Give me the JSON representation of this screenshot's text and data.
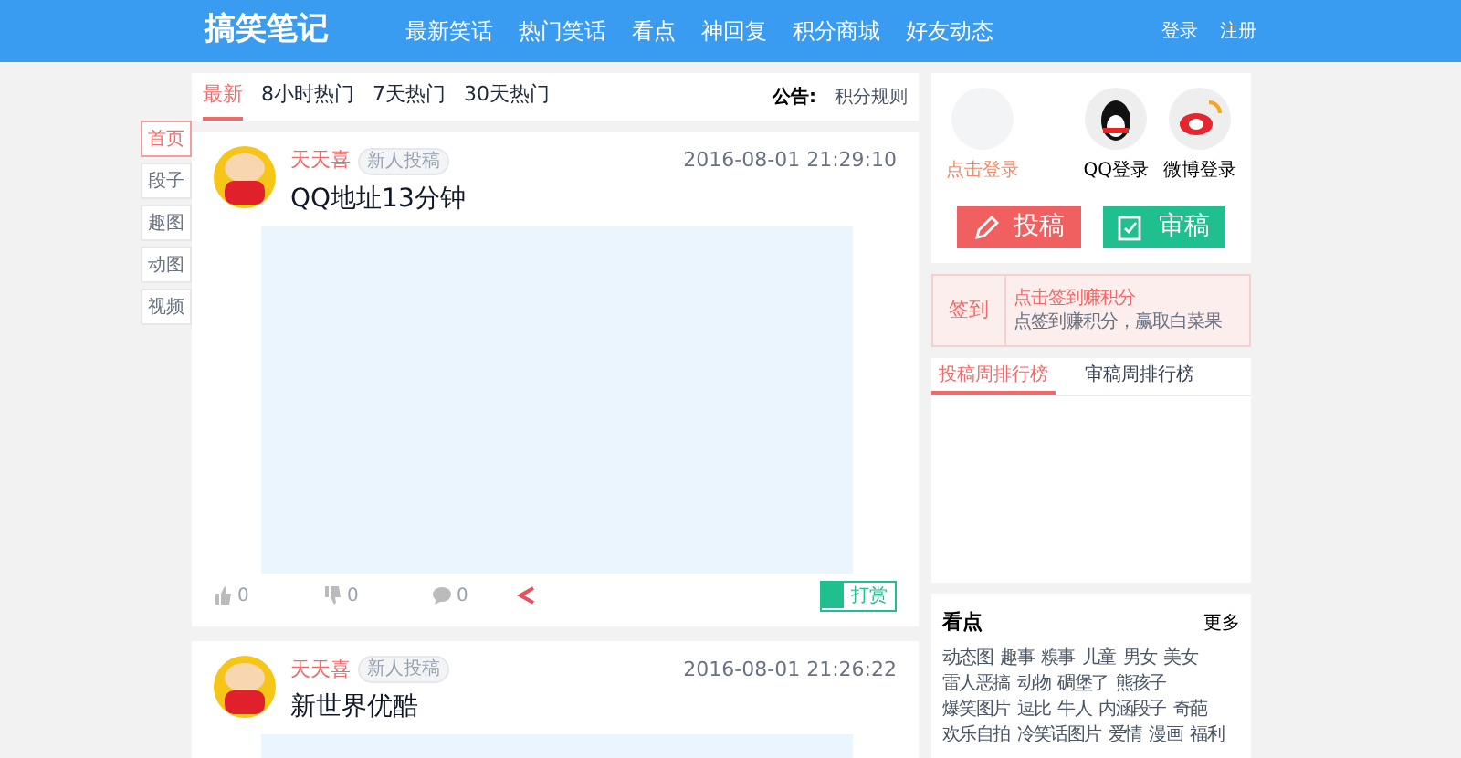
{
  "header": {
    "logo": "搞笑笔记",
    "nav": [
      {
        "label": "最新笑话"
      },
      {
        "label": "热门笑话"
      },
      {
        "label": "看点"
      },
      {
        "label": "神回复"
      },
      {
        "label": "积分商城"
      },
      {
        "label": "好友动态"
      }
    ],
    "actions": [
      "登录",
      "注册"
    ]
  },
  "side_tabs": [
    {
      "label": "首页",
      "selected": true
    },
    {
      "label": "段子",
      "selected": false
    },
    {
      "label": "趣图",
      "selected": false
    },
    {
      "label": "动图",
      "selected": false
    },
    {
      "label": "视频",
      "selected": false
    }
  ],
  "feed_tabs": [
    {
      "label": "最新",
      "selected": true
    },
    {
      "label": "8小时热门",
      "selected": false
    },
    {
      "label": "7天热门",
      "selected": false
    },
    {
      "label": "30天热门",
      "selected": false
    }
  ],
  "notice": {
    "label": "公告:",
    "link": "积分规则"
  },
  "posts": [
    {
      "author": "天天喜",
      "badge": "新人投稿",
      "time": "2016-08-01 21:29:10",
      "title": "QQ地址13分钟",
      "likes": "0",
      "dislikes": "0",
      "comments": "0",
      "tip": "打赏"
    },
    {
      "author": "天天喜",
      "badge": "新人投稿",
      "time": "2016-08-01 21:26:22",
      "title": "新世界优酷"
    }
  ],
  "login": {
    "prompt": "点击登录",
    "qq": "QQ登录",
    "weibo": "微博登录"
  },
  "buttons": {
    "submit": "投稿",
    "review": "审稿"
  },
  "signin": {
    "label": "签到",
    "hint": "点击签到赚积分",
    "desc": "点签到赚积分，赢取白菜果"
  },
  "rank_tabs": [
    {
      "label": "投稿周排行榜",
      "selected": true
    },
    {
      "label": "审稿周排行榜",
      "selected": false
    }
  ],
  "hot": {
    "title": "看点",
    "more": "更多",
    "tags": [
      "动态图",
      "趣事",
      "糗事",
      "儿童",
      "男女",
      "美女",
      "雷人恶搞",
      "动物",
      "碉堡了",
      "熊孩子",
      "爆笑图片",
      "逗比",
      "牛人",
      "内涵段子",
      "奇葩",
      "欢乐自拍",
      "冷笑话图片",
      "爱情",
      "漫画",
      "福利"
    ]
  }
}
